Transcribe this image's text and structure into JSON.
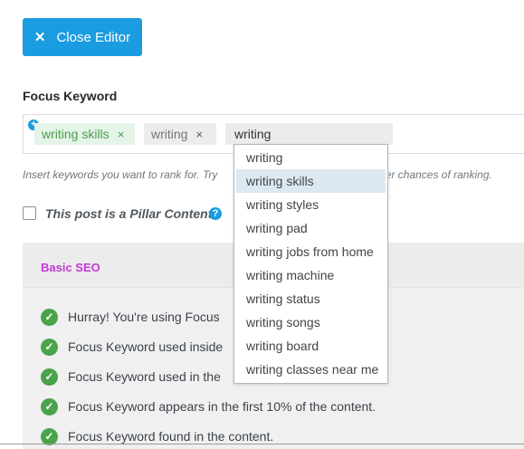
{
  "close_editor": {
    "icon": "close-icon",
    "label": "Close Editor"
  },
  "focus_keyword": {
    "label": "Focus Keyword",
    "tags": [
      {
        "text": "writing skills",
        "remove": "×",
        "color": "#4c9f4c"
      },
      {
        "text": "writing",
        "remove": "×",
        "color": "#777777"
      }
    ],
    "input_value": "writing",
    "help_text": "Insert keywords you want to rank for. Try",
    "help_text_end": "etter chances of ranking.",
    "suggestions": [
      "writing",
      "writing skills",
      "writing styles",
      "writing pad",
      "writing jobs from home",
      "writing machine",
      "writing status",
      "writing songs",
      "writing board",
      "writing classes near me"
    ],
    "active_suggestion": 1
  },
  "pillar": {
    "label": "This post is a Pillar Content",
    "help": "?",
    "checked": false
  },
  "basic_seo": {
    "title": "Basic SEO",
    "checks": [
      "Hurray! You're using Focus",
      "Focus Keyword used inside",
      "Focus Keyword used in the",
      "Focus Keyword appears in the first 10% of the content.",
      "Focus Keyword found in the content."
    ],
    "check_color": "#4aa34a"
  },
  "colors": {
    "accent": "#1a9ce0",
    "section_title": "#c13bd4"
  }
}
